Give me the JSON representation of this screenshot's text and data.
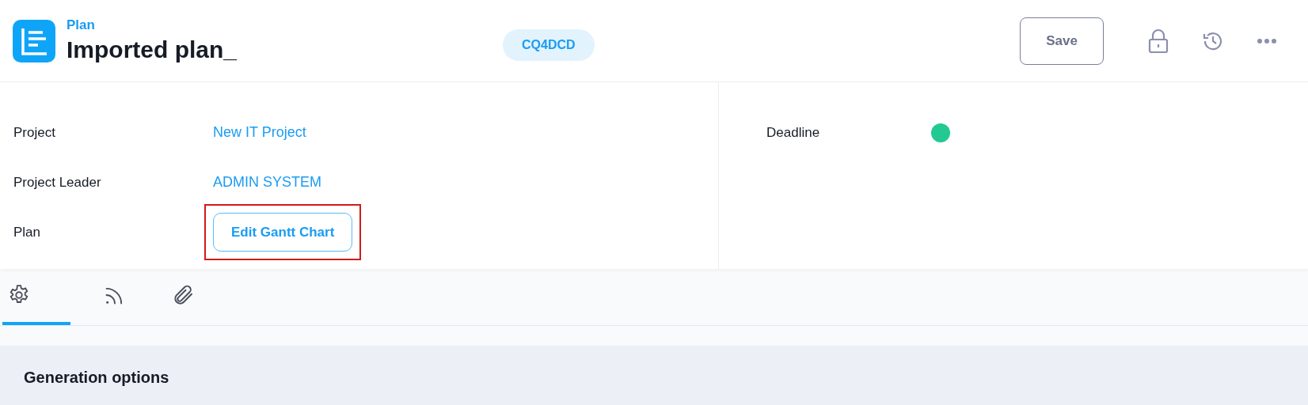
{
  "header": {
    "breadcrumb": "Plan",
    "title": "Imported plan_",
    "code_badge": "CQ4DCD",
    "save_button": "Save"
  },
  "fields_left": [
    {
      "label": "Project",
      "kind": "link",
      "value": "New IT Project"
    },
    {
      "label": "Project Leader",
      "kind": "link",
      "value": "ADMIN SYSTEM"
    },
    {
      "label": "Plan",
      "kind": "button",
      "value": "Edit Gantt Chart",
      "highlighted": true
    }
  ],
  "fields_right": [
    {
      "label": "Deadline",
      "kind": "dot",
      "color": "#22c993"
    }
  ],
  "tabs": [
    {
      "kind": "settings",
      "selected": true
    },
    {
      "kind": "feed",
      "selected": false
    },
    {
      "kind": "attachment",
      "selected": false
    }
  ],
  "section": {
    "title": "Generation options"
  }
}
